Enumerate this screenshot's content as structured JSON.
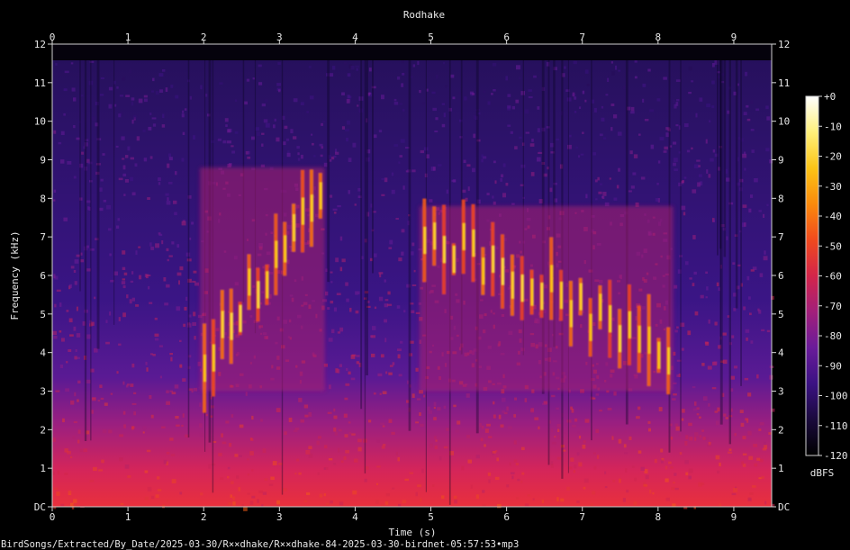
{
  "chart_data": {
    "type": "heatmap",
    "title": "Rodhake",
    "xlabel": "Time (s)",
    "ylabel": "Frequency (kHz)",
    "xlim": [
      0,
      9.5
    ],
    "ylim": [
      0,
      12
    ],
    "x_ticks": [
      "0",
      "1",
      "2",
      "3",
      "4",
      "5",
      "6",
      "7",
      "8",
      "9"
    ],
    "x_tick_values": [
      0,
      1,
      2,
      3,
      4,
      5,
      6,
      7,
      8,
      9
    ],
    "y_ticks": [
      "DC",
      "1",
      "2",
      "3",
      "4",
      "5",
      "6",
      "7",
      "8",
      "9",
      "10",
      "11",
      "12"
    ],
    "y_tick_values": [
      0,
      1,
      2,
      3,
      4,
      5,
      6,
      7,
      8,
      9,
      10,
      11,
      12
    ],
    "colorbar": {
      "label": "dBFS",
      "range": [
        -120,
        0
      ],
      "ticks": [
        "+0",
        "-10",
        "-20",
        "-30",
        "-40",
        "-50",
        "-60",
        "-70",
        "-80",
        "-90",
        "-100",
        "-110",
        "-120"
      ],
      "tick_values": [
        0,
        -10,
        -20,
        -30,
        -40,
        -50,
        -60,
        -70,
        -80,
        -90,
        -100,
        -110,
        -120
      ],
      "colors": [
        "#000000",
        "#1a0a3c",
        "#3b1283",
        "#6a1b9a",
        "#a21f7a",
        "#d3254a",
        "#f04a1e",
        "#fb8a0c",
        "#fcc416",
        "#fff07a",
        "#ffffff"
      ]
    },
    "calls": [
      {
        "start_s": 1.95,
        "end_s": 3.6,
        "freq_low_khz": 3.0,
        "freq_high_khz": 8.8,
        "peak_dbfs": -25
      },
      {
        "start_s": 4.85,
        "end_s": 8.2,
        "freq_low_khz": 3.0,
        "freq_high_khz": 7.8,
        "peak_dbfs": -25
      }
    ],
    "grid": false
  },
  "footer": {
    "path": "BirdSongs/Extracted/By_Date/2025-03-30/R××dhake/R××dhake-84-2025-03-30-birdnet-05:57:53•mp3"
  }
}
